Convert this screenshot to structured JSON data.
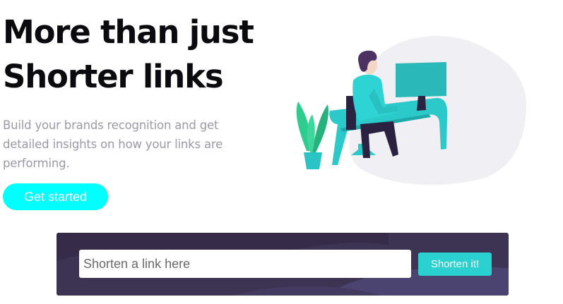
{
  "hero": {
    "title_line1": "More than just",
    "title_line2": "Shorter links",
    "subtitle": "Build your brands recognition and get detailed insights on how your links are performing.",
    "cta_label": "Get started"
  },
  "illustration": {
    "icon": "person-working-at-desk-illustration"
  },
  "shorten": {
    "placeholder": "Shorten a link here",
    "value": "",
    "button_label": "Shorten it!"
  },
  "colors": {
    "accent": "#00ffff",
    "button_teal": "#2bd0d0",
    "panel": "#3d3353",
    "title": "#0b0b0f",
    "subtitle": "#9a9aa6"
  }
}
